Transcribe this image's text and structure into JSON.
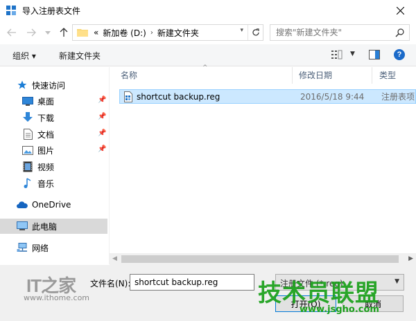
{
  "window": {
    "title": "导入注册表文件"
  },
  "address": {
    "overflow": "«",
    "segments": [
      "新加卷 (D:)",
      "新建文件夹"
    ],
    "search_placeholder": "搜索\"新建文件夹\""
  },
  "toolbar": {
    "organize": "组织 ▾",
    "new_folder": "新建文件夹",
    "help": "?"
  },
  "nav": {
    "quick_access": "快速访问",
    "items": [
      {
        "label": "桌面",
        "icon": "desktop-icon",
        "pinned": true
      },
      {
        "label": "下载",
        "icon": "download-icon",
        "pinned": true
      },
      {
        "label": "文档",
        "icon": "documents-icon",
        "pinned": true
      },
      {
        "label": "图片",
        "icon": "pictures-icon",
        "pinned": true
      },
      {
        "label": "视频",
        "icon": "videos-icon",
        "pinned": false
      },
      {
        "label": "音乐",
        "icon": "music-icon",
        "pinned": false
      }
    ],
    "onedrive": "OneDrive",
    "this_pc": "此电脑",
    "network": "网络"
  },
  "columns": {
    "name": "名称",
    "modified": "修改日期",
    "type": "类型"
  },
  "files": [
    {
      "name": "shortcut backup.reg",
      "modified": "2016/5/18 9:44",
      "type": "注册表项"
    }
  ],
  "bottom": {
    "filename_label": "文件名(N):",
    "filename_value": "shortcut backup.reg",
    "filetype_value": "注册文件 (*.reg)",
    "open_label": "打开(O)",
    "cancel_label": "取消"
  },
  "watermarks": {
    "ithome_logo": "IT之家",
    "ithome_url": "www.ithome.com",
    "jsgho_text": "技术员联盟",
    "jsgho_url": "www.jsgho.com"
  },
  "colors": {
    "selection": "#cce8ff",
    "help": "#1b6ac9",
    "watermark": "#1aa01a"
  }
}
